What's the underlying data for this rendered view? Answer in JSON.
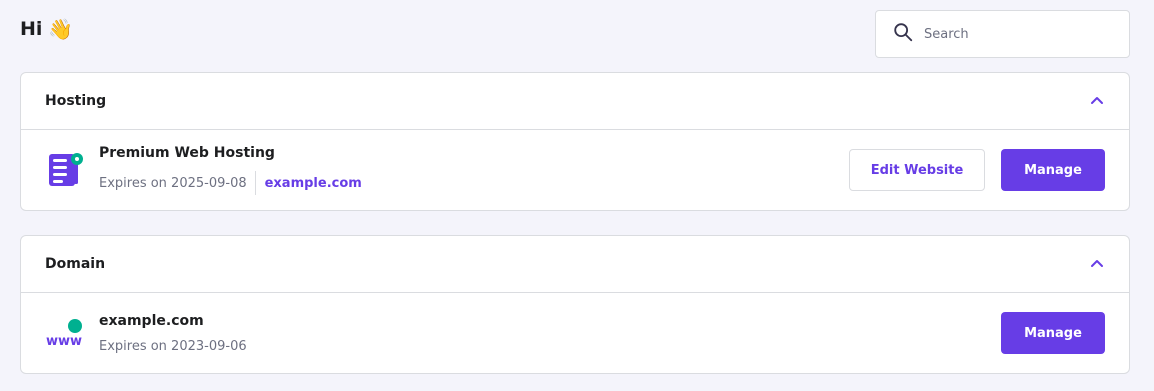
{
  "greeting": {
    "text": "Hi",
    "emoji": "👋"
  },
  "search": {
    "placeholder": "Search",
    "value": ""
  },
  "colors": {
    "accent": "#673de6",
    "teal": "#00b090",
    "border": "#dadce0",
    "muted": "#6d7081"
  },
  "sections": {
    "hosting": {
      "title": "Hosting",
      "product_name": "Premium Web Hosting",
      "expires": "Expires on 2025-09-08",
      "domain_link": "example.com",
      "edit_label": "Edit Website",
      "manage_label": "Manage",
      "icon": "server-icon"
    },
    "domain": {
      "title": "Domain",
      "product_name": "example.com",
      "expires": "Expires on 2023-09-06",
      "manage_label": "Manage",
      "icon": "www-icon",
      "icon_text": "www"
    }
  }
}
